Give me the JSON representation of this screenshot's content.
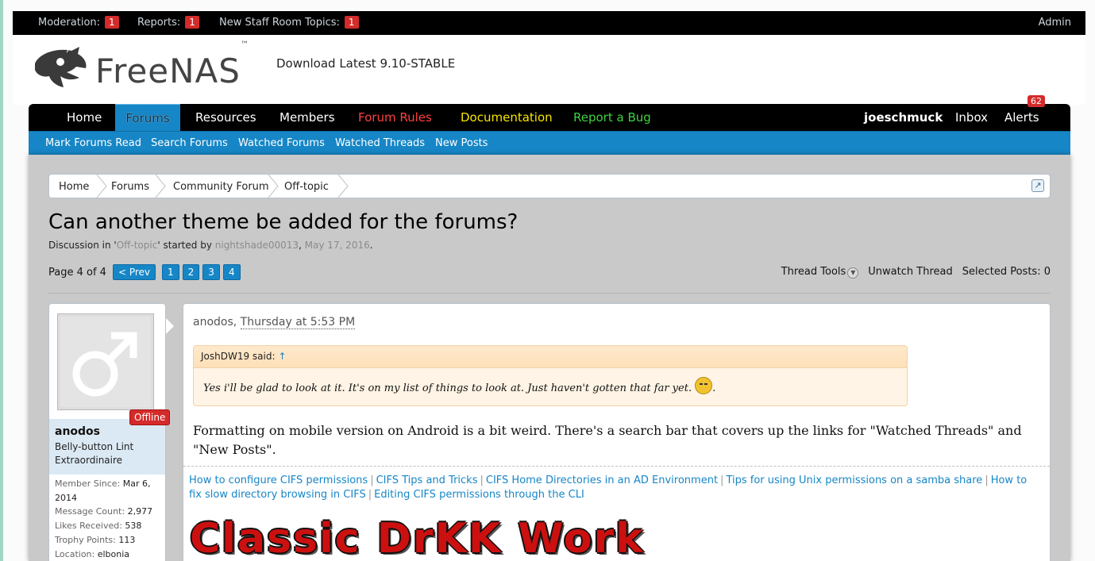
{
  "modbar": {
    "moderation_label": "Moderation:",
    "moderation_count": "1",
    "reports_label": "Reports:",
    "reports_count": "1",
    "staff_label": "New Staff Room Topics:",
    "staff_count": "1",
    "admin_label": "Admin"
  },
  "header": {
    "logo_text": "FreeNAS",
    "logo_tm": "™",
    "download_text": "Download Latest 9.10-STABLE"
  },
  "nav": {
    "tabs": [
      "Home",
      "Forums",
      "Resources",
      "Members",
      "Forum Rules",
      "Documentation",
      "Report a Bug"
    ],
    "user": "joeschmuck",
    "inbox": "Inbox",
    "alerts": "Alerts",
    "alerts_count": "62"
  },
  "subnav": [
    "Mark Forums Read",
    "Search Forums",
    "Watched Forums",
    "Watched Threads",
    "New Posts"
  ],
  "breadcrumb": [
    "Home",
    "Forums",
    "Community Forum",
    "Off-topic"
  ],
  "thread": {
    "title": "Can another theme be added for the forums?",
    "meta_prefix": "Discussion in '",
    "meta_forum": "Off-topic",
    "meta_mid": "' started by ",
    "meta_author": "nightshade00013",
    "meta_sep": ", ",
    "meta_date": "May 17, 2016",
    "meta_end": "."
  },
  "pagination": {
    "label": "Page 4 of 4",
    "prev": "< Prev",
    "pages": [
      "1",
      "2",
      "3",
      "4"
    ]
  },
  "tools": {
    "thread_tools": "Thread Tools",
    "unwatch": "Unwatch Thread",
    "selected_label": "Selected Posts:",
    "selected_count": "0"
  },
  "user": {
    "status": "Offline",
    "name": "anodos",
    "title": "Belly-button Lint Extraordinaire",
    "stats": [
      {
        "label": "Member Since:",
        "value": "Mar 6, 2014"
      },
      {
        "label": "Message Count:",
        "value": "2,977"
      },
      {
        "label": "Likes Received:",
        "value": "538"
      },
      {
        "label": "Trophy Points:",
        "value": "113"
      },
      {
        "label": "Location:",
        "value": "elbonia"
      }
    ]
  },
  "post": {
    "author": "anodos",
    "sep": ", ",
    "time": "Thursday at 5:53 PM",
    "quote_author": "JoshDW19 said:",
    "quote_arrow": "↑",
    "quote_text": "Yes i'll be glad to look at it. It's on my list of things to look at. Just haven't gotten that far yet.",
    "quote_end": ".",
    "body": "Formatting on mobile version on Android is a bit weird. There's a search bar that covers up the links for \"Watched Threads\" and \"New Posts\".",
    "sig_links": [
      "How to configure CIFS permissions",
      "CIFS Tips and Tricks",
      "CIFS Home Directories in an AD Environment",
      "Tips for using Unix permissions on a samba share",
      "How to fix slow directory browsing in CIFS",
      "Editing CIFS permissions through the CLI"
    ],
    "sig_separator": "|",
    "sig_banner": "Classic DrKK Work"
  },
  "colors": {
    "accent": "#1686c6",
    "badge_red": "#d52a2a",
    "forum_rules": "#ff4040",
    "documentation": "#f5e500",
    "report_bug": "#3fd13f"
  }
}
